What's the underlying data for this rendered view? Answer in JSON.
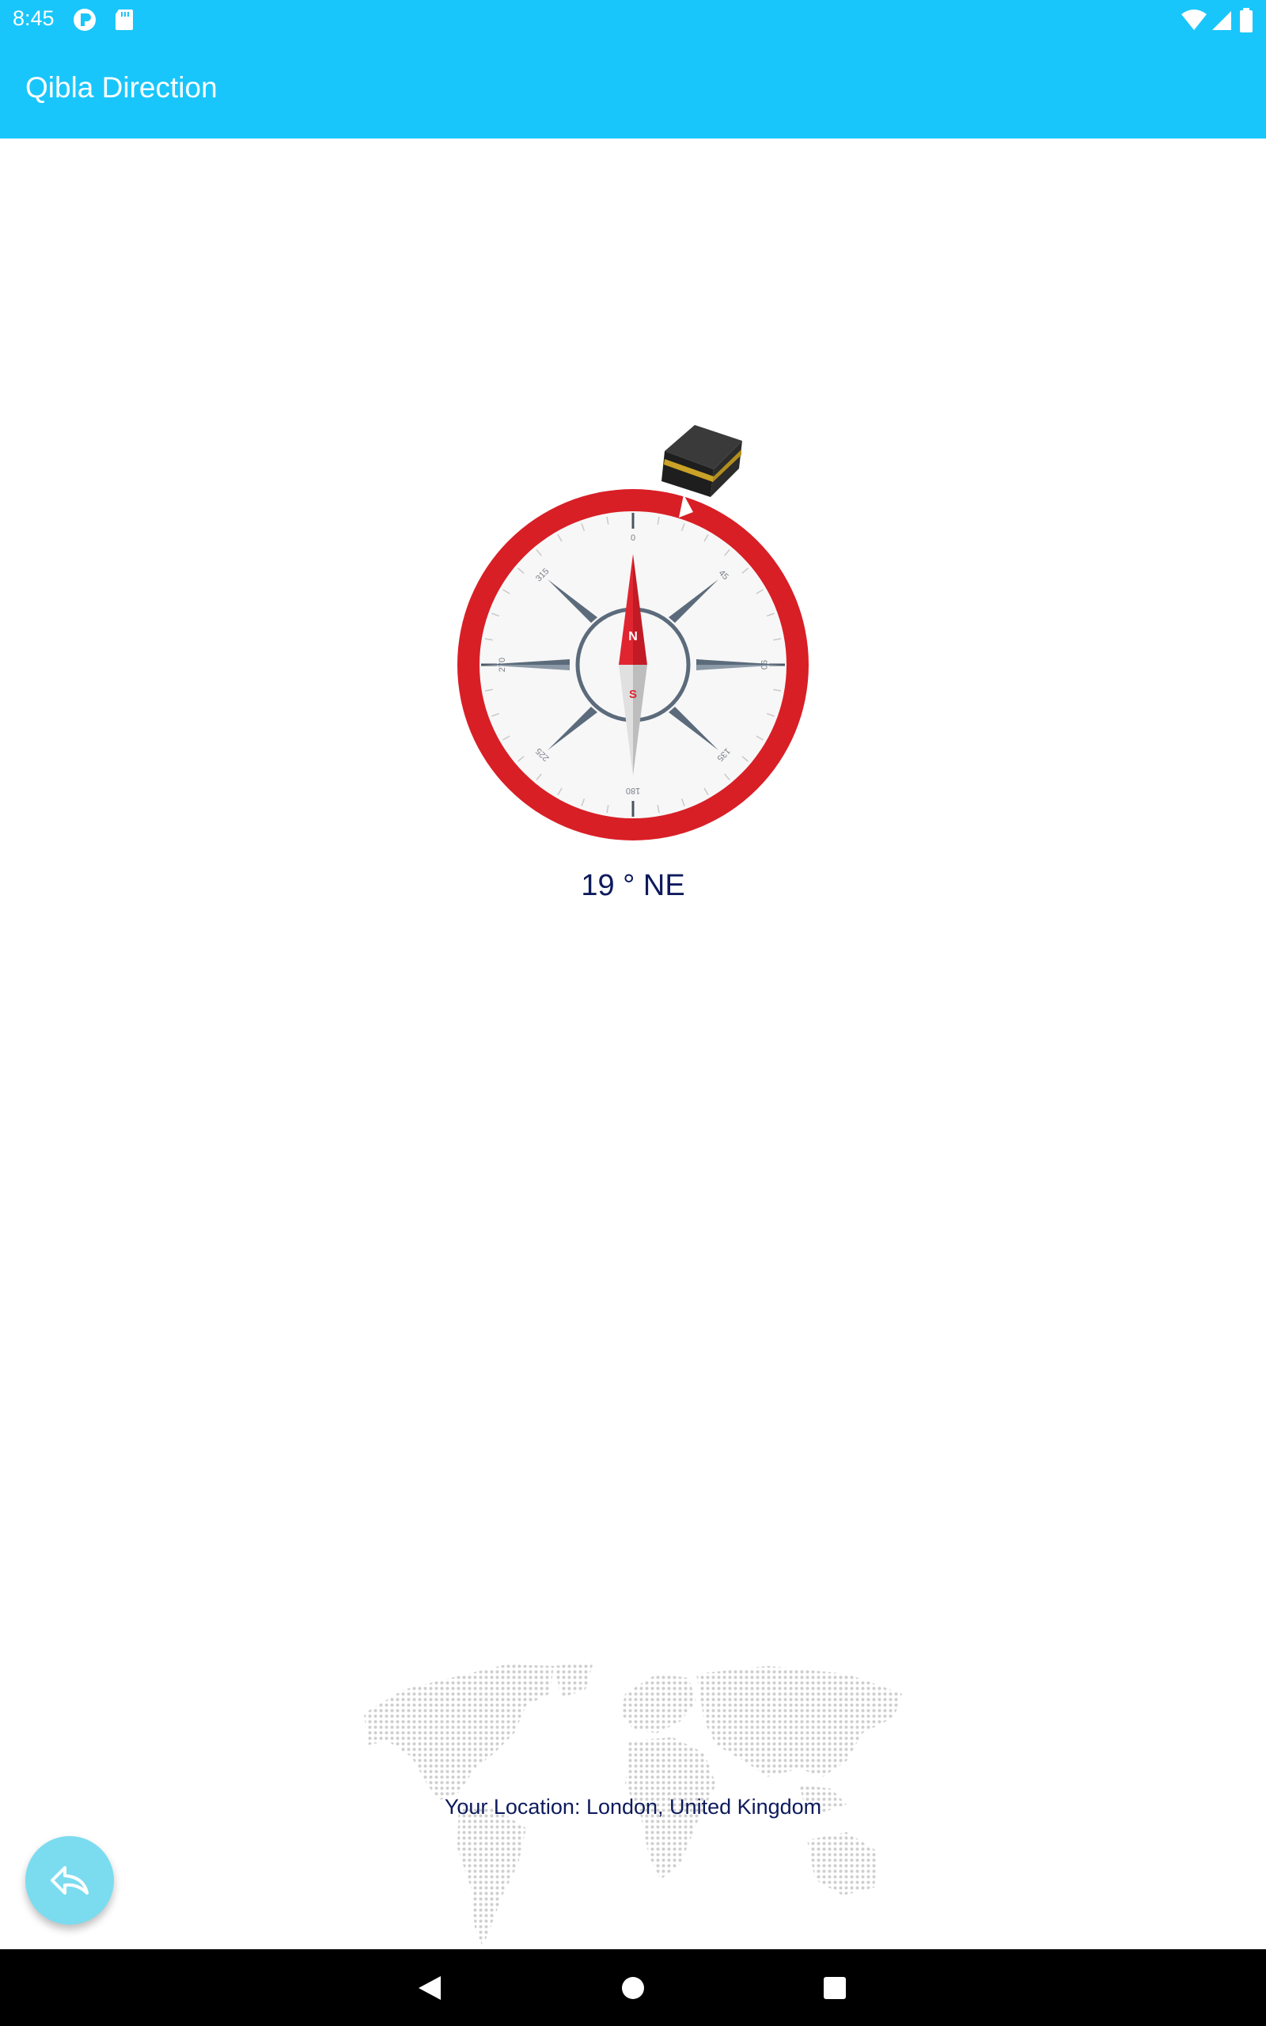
{
  "status_bar": {
    "time": "8:45",
    "icons": [
      "app-notification-icon",
      "sd-card-icon",
      "wifi-icon",
      "cellular-signal-icon",
      "battery-icon"
    ]
  },
  "app_bar": {
    "title": "Qibla Direction",
    "color": "#19c6fb"
  },
  "compass": {
    "tick_labels": [
      "0",
      "45",
      "90",
      "135",
      "180",
      "225",
      "270",
      "315"
    ],
    "needle_north_label": "N",
    "needle_south_label": "S",
    "ring_color": "#d81f26",
    "qibla_icon": "kaaba-icon"
  },
  "heading": {
    "text": "19 ° NE"
  },
  "location": {
    "text": "Your Location: London, United Kingdom"
  },
  "fab": {
    "icon": "reply-arrow-icon",
    "color": "#7bdcf0"
  },
  "nav_bar": {
    "icons": [
      "back-icon",
      "home-icon",
      "recents-icon"
    ]
  }
}
